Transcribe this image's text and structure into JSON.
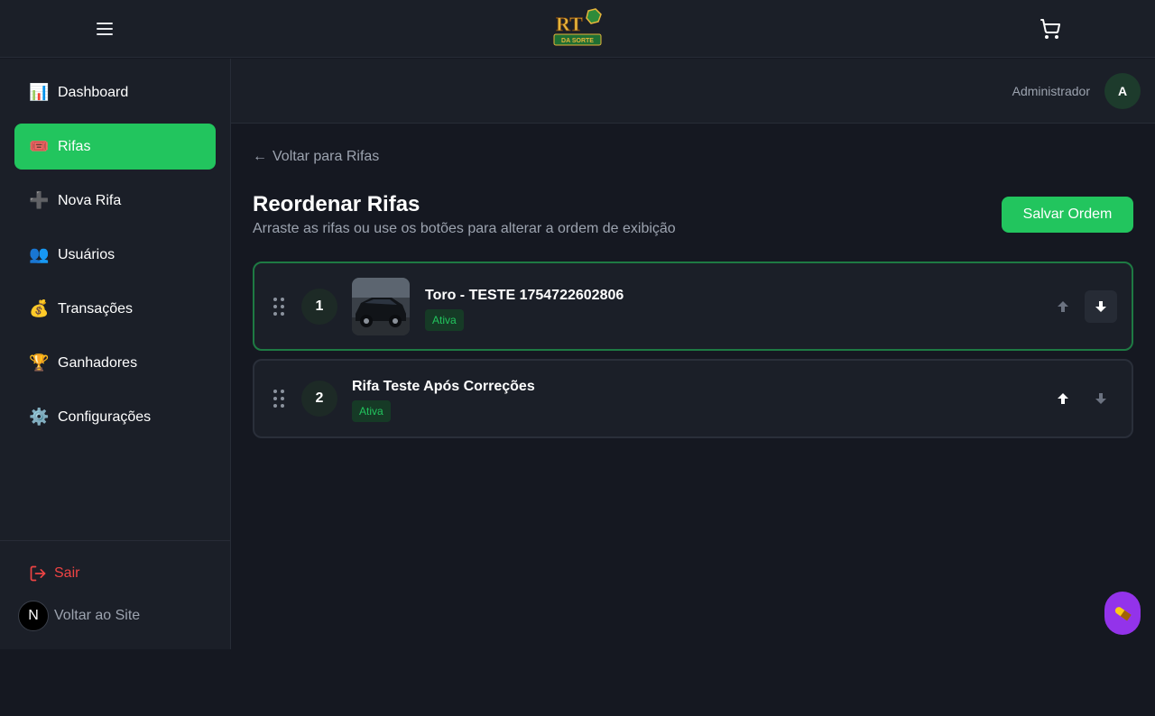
{
  "topbar": {
    "logo_text_top": "RT",
    "logo_text_bottom": "DA SORTE"
  },
  "sidebar": {
    "items": [
      {
        "label": "Dashboard",
        "icon": "📊"
      },
      {
        "label": "Rifas",
        "icon": "🎟️"
      },
      {
        "label": "Nova Rifa",
        "icon": "➕"
      },
      {
        "label": "Usuários",
        "icon": "👥"
      },
      {
        "label": "Transações",
        "icon": "💰"
      },
      {
        "label": "Ganhadores",
        "icon": "🏆"
      },
      {
        "label": "Configurações",
        "icon": "⚙️"
      }
    ],
    "logout_label": "Sair",
    "back_site_label": "Voltar ao Site",
    "back_site_initial": "N"
  },
  "admin": {
    "name": "Administrador",
    "initial": "A"
  },
  "page": {
    "back_link": "Voltar para Rifas",
    "back_arrow": "←",
    "title": "Reordenar Rifas",
    "subtitle": "Arraste as rifas ou use os botões para alterar a ordem de exibição",
    "save_label": "Salvar Ordem"
  },
  "raffles": [
    {
      "position": "1",
      "title": "Toro - TESTE 1754722602806",
      "status": "Ativa",
      "has_image": true
    },
    {
      "position": "2",
      "title": "Rifa Teste Após Correções",
      "status": "Ativa",
      "has_image": false
    }
  ],
  "colors": {
    "accent": "#22c55e",
    "danger": "#ef4444",
    "fab": "#9333ea"
  }
}
